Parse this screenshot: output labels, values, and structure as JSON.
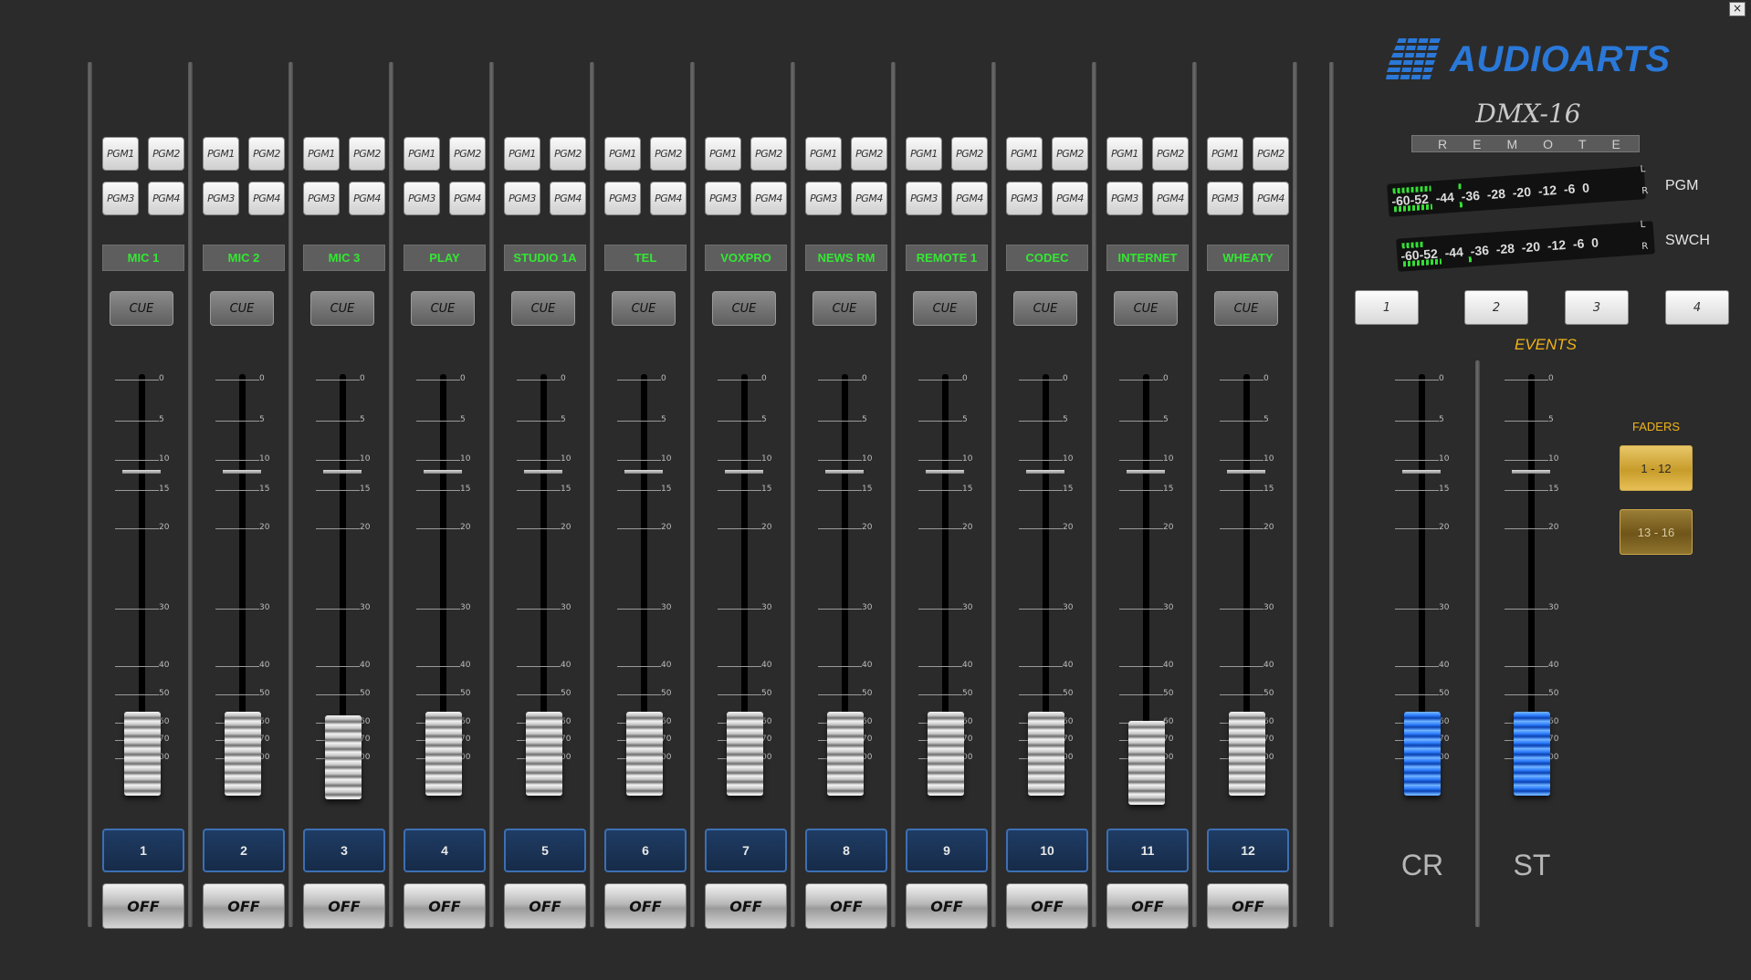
{
  "window": {
    "close_glyph": "×"
  },
  "brand": {
    "logo_text": "AUDIOARTS",
    "model": "DMX-16",
    "mode": "REMOTE"
  },
  "meters": [
    {
      "name": "PGM",
      "scale": "-60-52 -44 -36 -28 -20 -12 -6 0",
      "left_ch": "L",
      "right_ch": "R"
    },
    {
      "name": "SWCH",
      "scale": "-60-52 -44 -36 -28 -20 -12 -6 0",
      "left_ch": "L",
      "right_ch": "R"
    }
  ],
  "events": {
    "label": "EVENTS",
    "buttons": [
      "1",
      "2",
      "3",
      "4"
    ]
  },
  "fader_banks": {
    "label": "FADERS",
    "buttons": [
      {
        "label": "1 - 12",
        "active": true
      },
      {
        "label": "13 - 16",
        "active": false
      }
    ]
  },
  "fader_scale": [
    "0",
    "5",
    "10",
    "15",
    "20",
    "30",
    "40",
    "50",
    "60",
    "70",
    "00"
  ],
  "channels": [
    {
      "number": "1",
      "source": "MIC 1",
      "cue": "CUE",
      "off": "OFF",
      "assign": [
        "PGM1",
        "PGM2",
        "PGM3",
        "PGM4"
      ],
      "level": 0
    },
    {
      "number": "2",
      "source": "MIC 2",
      "cue": "CUE",
      "off": "OFF",
      "assign": [
        "PGM1",
        "PGM2",
        "PGM3",
        "PGM4"
      ],
      "level": 0
    },
    {
      "number": "3",
      "source": "MIC 3",
      "cue": "CUE",
      "off": "OFF",
      "assign": [
        "PGM1",
        "PGM2",
        "PGM3",
        "PGM4"
      ],
      "level": 0
    },
    {
      "number": "4",
      "source": "PLAY",
      "cue": "CUE",
      "off": "OFF",
      "assign": [
        "PGM1",
        "PGM2",
        "PGM3",
        "PGM4"
      ],
      "level": 0
    },
    {
      "number": "5",
      "source": "STUDIO 1A",
      "cue": "CUE",
      "off": "OFF",
      "assign": [
        "PGM1",
        "PGM2",
        "PGM3",
        "PGM4"
      ],
      "level": 0
    },
    {
      "number": "6",
      "source": "TEL",
      "cue": "CUE",
      "off": "OFF",
      "assign": [
        "PGM1",
        "PGM2",
        "PGM3",
        "PGM4"
      ],
      "level": 0
    },
    {
      "number": "7",
      "source": "VOXPRO",
      "cue": "CUE",
      "off": "OFF",
      "assign": [
        "PGM1",
        "PGM2",
        "PGM3",
        "PGM4"
      ],
      "level": 0
    },
    {
      "number": "8",
      "source": "NEWS RM",
      "cue": "CUE",
      "off": "OFF",
      "assign": [
        "PGM1",
        "PGM2",
        "PGM3",
        "PGM4"
      ],
      "level": 0
    },
    {
      "number": "9",
      "source": "REMOTE 1",
      "cue": "CUE",
      "off": "OFF",
      "assign": [
        "PGM1",
        "PGM2",
        "PGM3",
        "PGM4"
      ],
      "level": 0
    },
    {
      "number": "10",
      "source": "CODEC",
      "cue": "CUE",
      "off": "OFF",
      "assign": [
        "PGM1",
        "PGM2",
        "PGM3",
        "PGM4"
      ],
      "level": 0
    },
    {
      "number": "11",
      "source": "INTERNET",
      "cue": "CUE",
      "off": "OFF",
      "assign": [
        "PGM1",
        "PGM2",
        "PGM3",
        "PGM4"
      ],
      "level": 0
    },
    {
      "number": "12",
      "source": "WHEATY",
      "cue": "CUE",
      "off": "OFF",
      "assign": [
        "PGM1",
        "PGM2",
        "PGM3",
        "PGM4"
      ],
      "level": 0
    }
  ],
  "masters": [
    {
      "label": "CR",
      "level": 0
    },
    {
      "label": "ST",
      "level": 0
    }
  ],
  "colors": {
    "background": "#2b2b2b",
    "source_text": "#33e833",
    "accent_gold": "#f0b419",
    "brand_blue": "#2a78d8",
    "channel_blue": "#3d6fb3"
  }
}
